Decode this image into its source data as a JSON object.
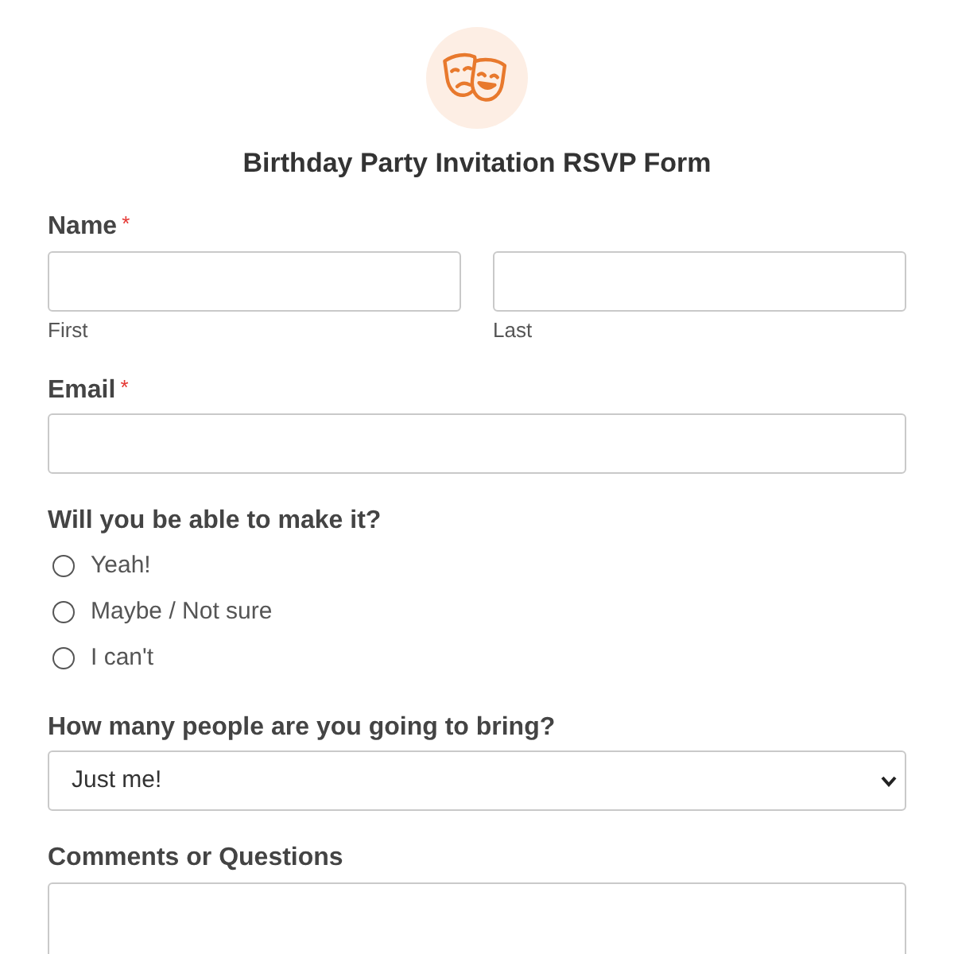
{
  "header": {
    "title": "Birthday Party Invitation RSVP Form"
  },
  "fields": [
    {
      "kind": "name",
      "label": "Name",
      "required_mark": "*",
      "subfields": [
        {
          "sublabel": "First"
        },
        {
          "sublabel": "Last"
        }
      ]
    },
    {
      "kind": "text",
      "label": "Email",
      "required_mark": "*"
    },
    {
      "kind": "radio",
      "label": "Will you be able to make it?",
      "options": [
        {
          "label": "Yeah!",
          "selected": false
        },
        {
          "label": "Maybe / Not sure",
          "selected": false
        },
        {
          "label": "I can't",
          "selected": false
        }
      ]
    },
    {
      "kind": "select",
      "label": "How many people are you going to bring?",
      "value": "Just me!"
    },
    {
      "kind": "textarea",
      "label": "Comments or Questions"
    }
  ]
}
